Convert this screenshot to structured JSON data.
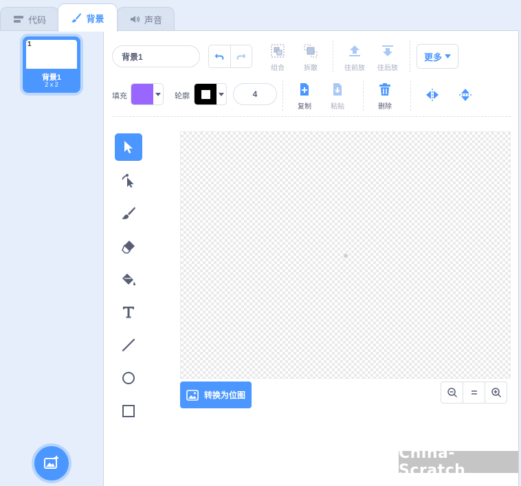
{
  "tabs": [
    {
      "label": "代码",
      "icon": "code-icon",
      "active": false
    },
    {
      "label": "背景",
      "icon": "brush-icon",
      "active": true
    },
    {
      "label": "声音",
      "icon": "speaker-icon",
      "active": false
    }
  ],
  "costume_list": {
    "items": [
      {
        "number": "1",
        "name": "背景1",
        "size": "2 x 2",
        "selected": true
      }
    ],
    "add_button_icon": "add-backdrop-icon"
  },
  "paint_editor": {
    "costume_name": "背景1",
    "undo_icon": "undo-icon",
    "redo_icon": "redo-icon",
    "group_label": "组合",
    "ungroup_label": "拆散",
    "forward_label": "往前放",
    "backward_label": "往后放",
    "more_label": "更多",
    "fill_label": "填充",
    "fill_color": "#9966ff",
    "outline_label": "轮廓",
    "outline_color": "#000000",
    "outline_width": "4",
    "copy_label": "复制",
    "paste_label": "粘贴",
    "delete_label": "删除",
    "convert_label": "转换为位图"
  },
  "tools": [
    {
      "name": "select",
      "icon": "select-arrow-icon",
      "active": true
    },
    {
      "name": "reshape",
      "icon": "reshape-icon",
      "active": false
    },
    {
      "name": "brush",
      "icon": "brush-icon",
      "active": false
    },
    {
      "name": "eraser",
      "icon": "eraser-icon",
      "active": false
    },
    {
      "name": "fill",
      "icon": "fill-bucket-icon",
      "active": false
    },
    {
      "name": "text",
      "icon": "text-icon",
      "active": false
    },
    {
      "name": "line",
      "icon": "line-icon",
      "active": false
    },
    {
      "name": "circle",
      "icon": "circle-icon",
      "active": false
    },
    {
      "name": "rectangle",
      "icon": "rectangle-icon",
      "active": false
    }
  ],
  "zoom": {
    "out_icon": "zoom-out-icon",
    "reset_icon": "zoom-reset-icon",
    "in_icon": "zoom-in-icon"
  },
  "colors": {
    "accent": "#4c97ff",
    "text": "#575e75",
    "dim": "#a8aebf",
    "pane_bg": "#e5eefa"
  },
  "watermark": "China-Scratch"
}
